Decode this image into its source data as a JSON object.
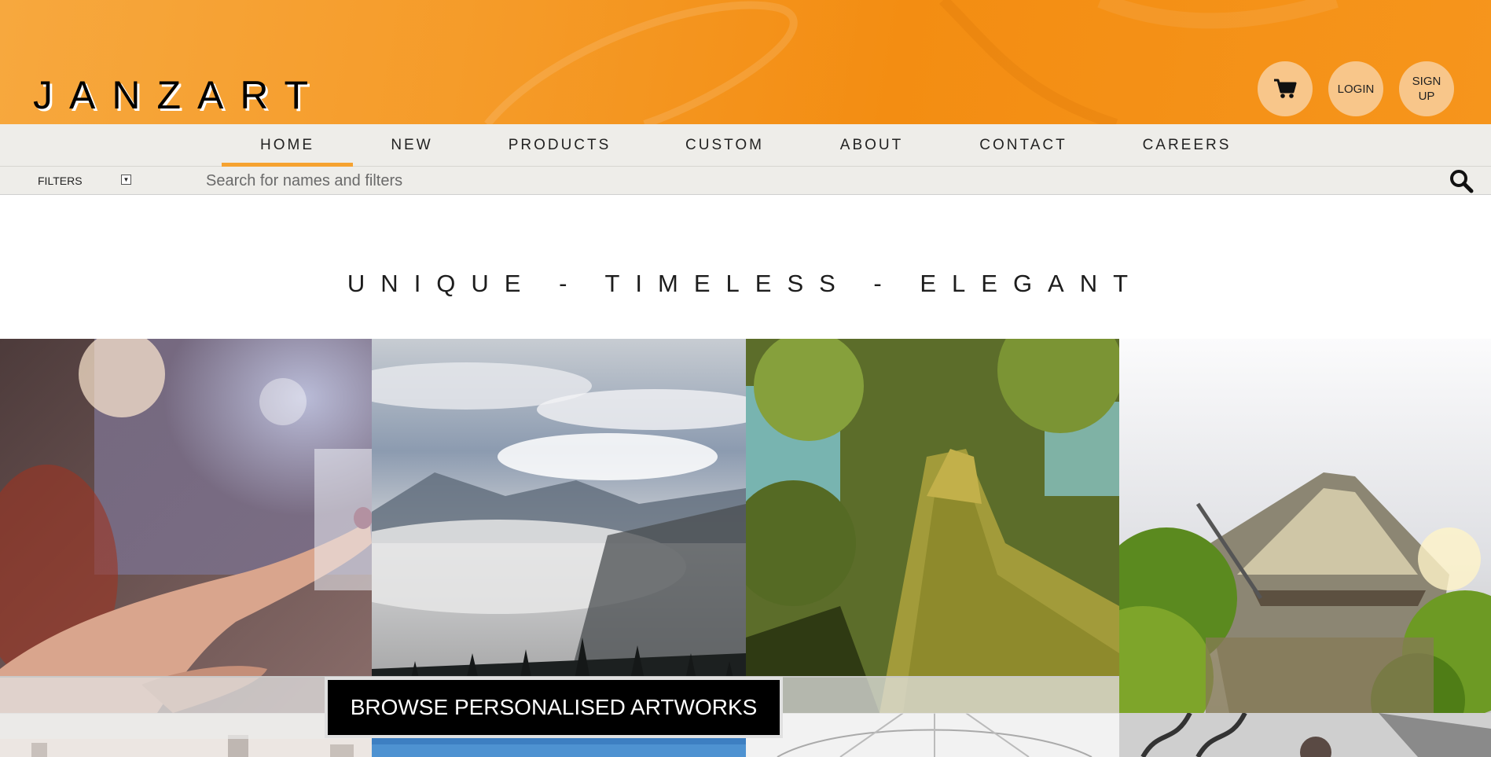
{
  "brand": {
    "logo": "JANZART"
  },
  "header": {
    "cart_icon": "cart-icon",
    "login_label": "LOGIN",
    "signup_label_line1": "SIGN",
    "signup_label_line2": "UP"
  },
  "nav": {
    "items": [
      {
        "label": "HOME",
        "active": true
      },
      {
        "label": "NEW",
        "active": false
      },
      {
        "label": "PRODUCTS",
        "active": false
      },
      {
        "label": "CUSTOM",
        "active": false
      },
      {
        "label": "ABOUT",
        "active": false
      },
      {
        "label": "CONTACT",
        "active": false
      },
      {
        "label": "CAREERS",
        "active": false
      }
    ]
  },
  "filterbar": {
    "filters_label": "FILTERS",
    "caret_icon": "chevron-down-icon",
    "search_placeholder": "Search for names and filters",
    "search_value": "",
    "search_icon": "search-icon"
  },
  "hero": {
    "tagline": "UNIQUE - TIMELESS - ELEGANT"
  },
  "gallery": {
    "cta_label": "BROWSE PERSONALISED ARTWORKS",
    "tiles": [
      "finger-touch-photo",
      "misty-mountains-photo",
      "mossy-tree-photo",
      "canoe-lake-photo",
      "city-skyline-photo",
      "blue-sky-photo",
      "glass-dome-photo",
      "metal-sculpture-photo"
    ]
  },
  "colors": {
    "accent": "#f6a230",
    "header_orange": "#f59a27",
    "nav_bg": "#eeede9",
    "button_bg": "#f8c68a"
  }
}
